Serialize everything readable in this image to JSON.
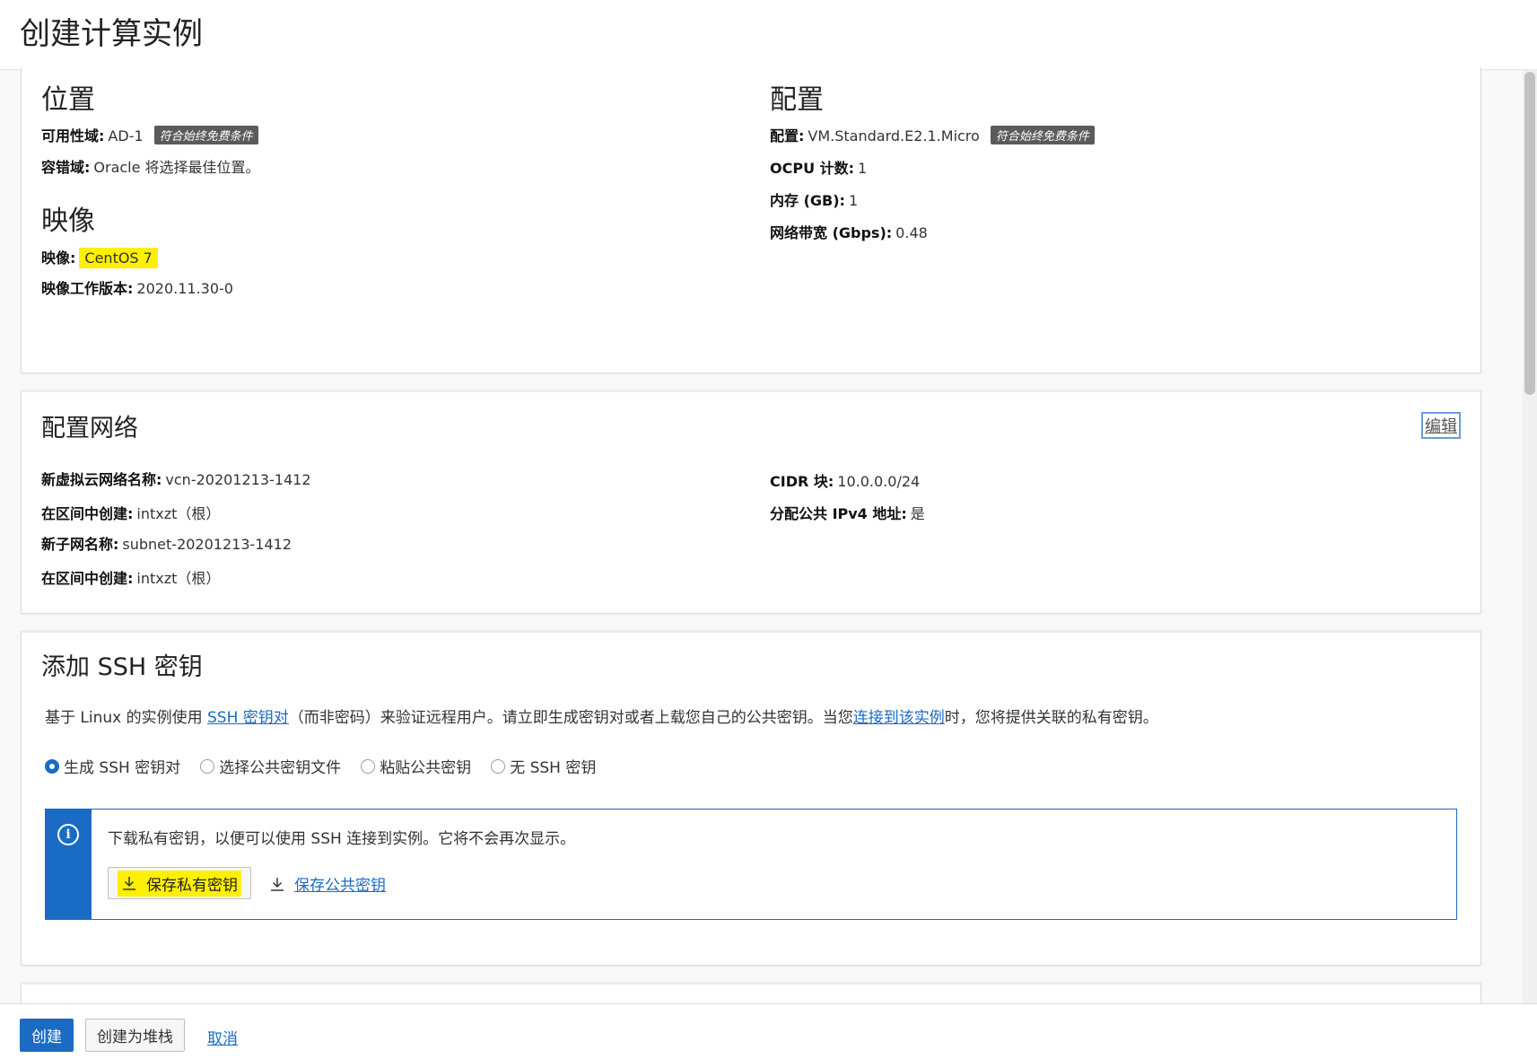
{
  "page_title": "创建计算实例",
  "placement": {
    "heading": "位置",
    "availability_domain": {
      "label": "可用性域:",
      "value": "AD-1",
      "badge": "符合始终免费条件"
    },
    "fault_domain": {
      "label": "容错域:",
      "value": "Oracle 将选择最佳位置。"
    }
  },
  "image": {
    "heading": "映像",
    "image": {
      "label": "映像:",
      "value": "CentOS 7"
    },
    "build": {
      "label": "映像工作版本:",
      "value": "2020.11.30-0"
    }
  },
  "shape": {
    "heading": "配置",
    "shape": {
      "label": "配置:",
      "value": "VM.Standard.E2.1.Micro",
      "badge": "符合始终免费条件"
    },
    "ocpu": {
      "label": "OCPU 计数:",
      "value": "1"
    },
    "memory": {
      "label": "内存 (GB):",
      "value": "1"
    },
    "bandwidth": {
      "label": "网络带宽 (Gbps):",
      "value": "0.48"
    }
  },
  "networking": {
    "heading": "配置网络",
    "edit_label": "编辑",
    "vcn_name": {
      "label": "新虚拟云网络名称:",
      "value": "vcn-20201213-1412"
    },
    "vcn_compartment": {
      "label": "在区间中创建:",
      "value": "intxzt（根）"
    },
    "subnet_name": {
      "label": "新子网名称:",
      "value": "subnet-20201213-1412"
    },
    "subnet_compartment": {
      "label": "在区间中创建:",
      "value": "intxzt（根）"
    },
    "cidr": {
      "label": "CIDR 块:",
      "value": "10.0.0.0/24"
    },
    "public_ip": {
      "label": "分配公共 IPv4 地址:",
      "value": "是"
    }
  },
  "ssh": {
    "heading": "添加 SSH 密钥",
    "desc_prefix": "基于 Linux 的实例使用 ",
    "desc_link1": "SSH 密钥对",
    "desc_middle": "（而非密码）来验证远程用户。请立即生成密钥对或者上载您自己的公共密钥。当您",
    "desc_link2": "连接到该实例",
    "desc_suffix": "时，您将提供关联的私有密钥。",
    "options": [
      "生成 SSH 密钥对",
      "选择公共密钥文件",
      "粘贴公共密钥",
      "无 SSH 密钥"
    ],
    "selected_option": "生成 SSH 密钥对",
    "info_text": "下载私有密钥，以便可以使用 SSH 连接到实例。它将不会再次显示。",
    "save_private_label": "保存私有密钥",
    "save_public_label": "保存公共密钥"
  },
  "footer": {
    "create_label": "创建",
    "create_stack_label": "创建为堆栈",
    "cancel_label": "取消"
  },
  "colors": {
    "accent": "#1a6bc4",
    "highlight": "#ffef00",
    "badge_bg": "#5b5b5b"
  },
  "icons": [
    "info-icon",
    "download-icon"
  ]
}
